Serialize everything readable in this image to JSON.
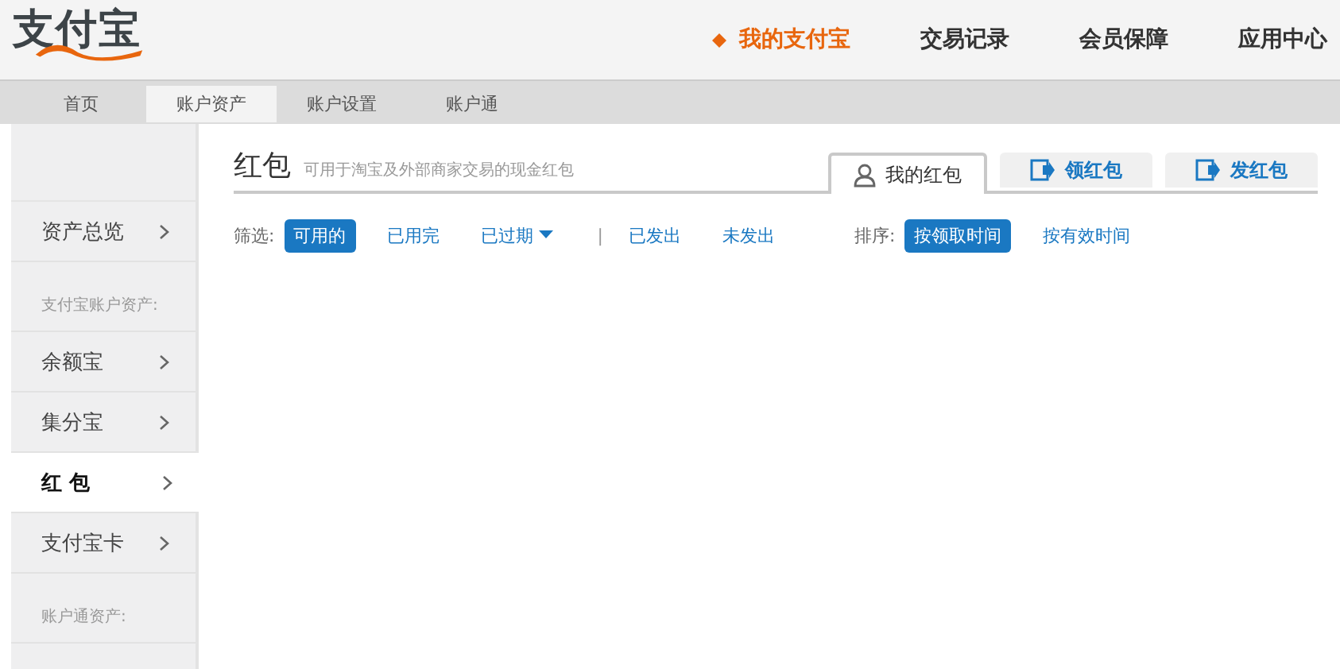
{
  "logo": {
    "text": "支付宝"
  },
  "top_nav": [
    {
      "label": "我的支付宝",
      "selected": true
    },
    {
      "label": "交易记录",
      "selected": false
    },
    {
      "label": "会员保障",
      "selected": false
    },
    {
      "label": "应用中心",
      "selected": false
    }
  ],
  "sub_nav": [
    {
      "label": "首页",
      "selected": false
    },
    {
      "label": "账户资产",
      "selected": true
    },
    {
      "label": "账户设置",
      "selected": false
    },
    {
      "label": "账户通",
      "selected": false
    }
  ],
  "sidebar": [
    {
      "kind": "item",
      "label": "资产总览",
      "selected": false
    },
    {
      "kind": "heading",
      "label": "支付宝账户资产:"
    },
    {
      "kind": "item",
      "label": "余额宝",
      "selected": false
    },
    {
      "kind": "item",
      "label": "集分宝",
      "selected": false
    },
    {
      "kind": "item",
      "label": "红 包",
      "selected": true
    },
    {
      "kind": "item",
      "label": "支付宝卡",
      "selected": false
    },
    {
      "kind": "heading",
      "label": "账户通资产:"
    }
  ],
  "page": {
    "title": "红包",
    "subtitle": "可用于淘宝及外部商家交易的现金红包"
  },
  "tabs": [
    {
      "label": "我的红包",
      "kind": "person",
      "selected": true
    },
    {
      "label": "领红包",
      "kind": "action",
      "selected": false
    },
    {
      "label": "发红包",
      "kind": "action",
      "selected": false
    }
  ],
  "filter": {
    "label": "筛选:",
    "options": [
      {
        "kind": "option",
        "label": "可用的",
        "selected": true
      },
      {
        "kind": "option",
        "label": "已用完",
        "selected": false
      },
      {
        "kind": "dropdown",
        "label": "已过期",
        "selected": false
      },
      {
        "kind": "separator",
        "label": "|"
      },
      {
        "kind": "option",
        "label": "已发出",
        "selected": false
      },
      {
        "kind": "option",
        "label": "未发出",
        "selected": false
      }
    ]
  },
  "sort": {
    "label": "排序:",
    "options": [
      {
        "label": "按领取时间",
        "selected": true
      },
      {
        "label": "按有效时间",
        "selected": false
      }
    ]
  }
}
